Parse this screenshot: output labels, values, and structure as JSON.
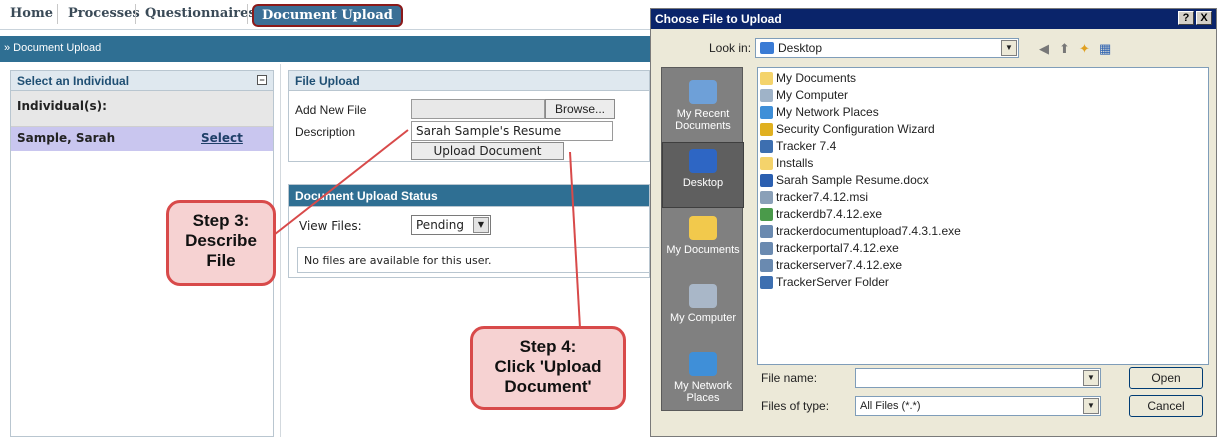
{
  "nav": {
    "home": "Home",
    "processes": "Processes",
    "questionnaires": "Questionnaires",
    "document_upload": "Document Upload"
  },
  "breadcrumb": "» Document Upload",
  "left_panel": {
    "title": "Select an Individual",
    "individuals_label": "Individual(s):",
    "row": {
      "name": "Sample, Sarah",
      "action": "Select"
    }
  },
  "upload_panel": {
    "title": "File Upload",
    "add_new_file_label": "Add New File",
    "description_label": "Description",
    "description_value": "Sarah Sample's Resume",
    "browse_label": "Browse...",
    "upload_button_label": "Upload Document"
  },
  "status_panel": {
    "title": "Document Upload Status",
    "view_files_label": "View Files:",
    "view_files_value": "Pending",
    "empty_message": "No files are available for this user."
  },
  "callouts": {
    "step3": [
      "Step 3:",
      "Describe",
      "File"
    ],
    "step4": [
      "Step 4:",
      "Click 'Upload",
      "Document'"
    ]
  },
  "dialog": {
    "title": "Choose File to Upload",
    "help": "?",
    "close": "X",
    "look_in_label": "Look in:",
    "look_in_value": "Desktop",
    "places": [
      {
        "label1": "My Recent",
        "label2": "Documents",
        "icon": "recent-documents-icon",
        "color": "#6ea0d8"
      },
      {
        "label1": "Desktop",
        "label2": "",
        "icon": "desktop-icon",
        "color": "#2e66c4"
      },
      {
        "label1": "My Documents",
        "label2": "",
        "icon": "my-documents-icon",
        "color": "#f2c94c"
      },
      {
        "label1": "My Computer",
        "label2": "",
        "icon": "my-computer-icon",
        "color": "#a9b7c8"
      },
      {
        "label1": "My Network",
        "label2": "Places",
        "icon": "network-places-icon",
        "color": "#3f8fd8"
      }
    ],
    "files": [
      {
        "name": "My Documents",
        "icon": "folder-icon",
        "color": "#f4d36b"
      },
      {
        "name": "My Computer",
        "icon": "computer-icon",
        "color": "#9fb3c8"
      },
      {
        "name": "My Network Places",
        "icon": "network-icon",
        "color": "#3f8fd8"
      },
      {
        "name": "Security Configuration Wizard",
        "icon": "shortcut-icon",
        "color": "#e0b020"
      },
      {
        "name": "Tracker 7.4",
        "icon": "shortcut-icon",
        "color": "#3d6fb0"
      },
      {
        "name": "Installs",
        "icon": "folder-icon",
        "color": "#f4d36b"
      },
      {
        "name": "Sarah Sample Resume.docx",
        "icon": "word-doc-icon",
        "color": "#2b5fb0"
      },
      {
        "name": "tracker7.4.12.msi",
        "icon": "msi-icon",
        "color": "#8aa0b8"
      },
      {
        "name": "trackerdb7.4.12.exe",
        "icon": "exe-icon",
        "color": "#4a9a4a"
      },
      {
        "name": "trackerdocumentupload7.4.3.1.exe",
        "icon": "exe-icon",
        "color": "#6a8ab0"
      },
      {
        "name": "trackerportal7.4.12.exe",
        "icon": "exe-icon",
        "color": "#6a8ab0"
      },
      {
        "name": "trackerserver7.4.12.exe",
        "icon": "exe-icon",
        "color": "#6a8ab0"
      },
      {
        "name": "TrackerServer Folder",
        "icon": "shortcut-icon",
        "color": "#3d6fb0"
      }
    ],
    "file_name_label": "File name:",
    "file_name_value": "",
    "files_of_type_label": "Files of type:",
    "files_of_type_value": "All Files (*.*)",
    "open_label": "Open",
    "cancel_label": "Cancel"
  },
  "colors": {
    "accent_blue": "#2f6f93",
    "callout_border": "#d84a4a",
    "callout_fill": "#f6d2d2",
    "selected_row": "#c9c6ef",
    "dialog_title": "#0a246a"
  }
}
